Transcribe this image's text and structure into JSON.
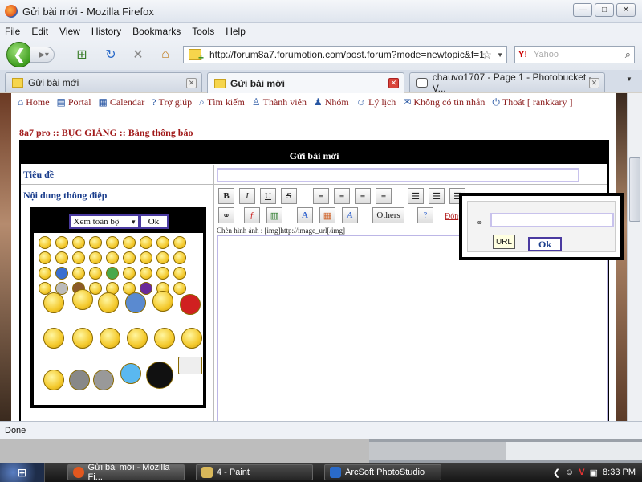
{
  "window": {
    "title": "Gửi bài mới - Mozilla Firefox",
    "min": "—",
    "max": "□",
    "close": "✕"
  },
  "menu": [
    "File",
    "Edit",
    "View",
    "History",
    "Bookmarks",
    "Tools",
    "Help"
  ],
  "nav": {
    "url": "http://forum8a7.forumotion.com/post.forum?mode=newtopic&f=1",
    "search_placeholder": "Yahoo",
    "search_engine": "Y!"
  },
  "tabs": [
    {
      "label": "Gửi bài mới"
    },
    {
      "label": "Gửi bài mới"
    },
    {
      "label": "chauvo1707 - Page 1 - Photobucket - V..."
    }
  ],
  "forum_nav": [
    {
      "label": "Home"
    },
    {
      "label": "Portal"
    },
    {
      "label": "Calendar"
    },
    {
      "label": "Trợ giúp"
    },
    {
      "label": "Tìm kiếm"
    },
    {
      "label": "Thành viên"
    },
    {
      "label": "Nhóm"
    },
    {
      "label": "Lý lịch"
    },
    {
      "label": "Không có tin nhắn"
    },
    {
      "label": "Thoát [ rankkary ]"
    }
  ],
  "breadcrumb": "8a7 pro  :: BỤC GIẢNG :: Bảng thông báo",
  "form": {
    "header": "Gửi bài mới",
    "subject_label": "Tiêu đề",
    "subject_value": "",
    "message_label": "Nội dung thông điệp",
    "img_hint": "Chèn hình ảnh : [img]http://image_url[/img]",
    "font_color_link": "Đóng",
    "others_label": "Others",
    "message_value": ""
  },
  "emoticons": {
    "select_value": "Xem toàn bộ",
    "ok_label": "Ok"
  },
  "url_popup": {
    "ok_label": "Ok",
    "tooltip": "URL",
    "url_value": ""
  },
  "status": "Done",
  "taskbar": {
    "tasks": [
      {
        "label": "Gửi bài mới - Mozilla Fi..."
      },
      {
        "label": "4 - Paint"
      },
      {
        "label": "ArcSoft PhotoStudio"
      }
    ],
    "clock": "8:33 PM"
  }
}
